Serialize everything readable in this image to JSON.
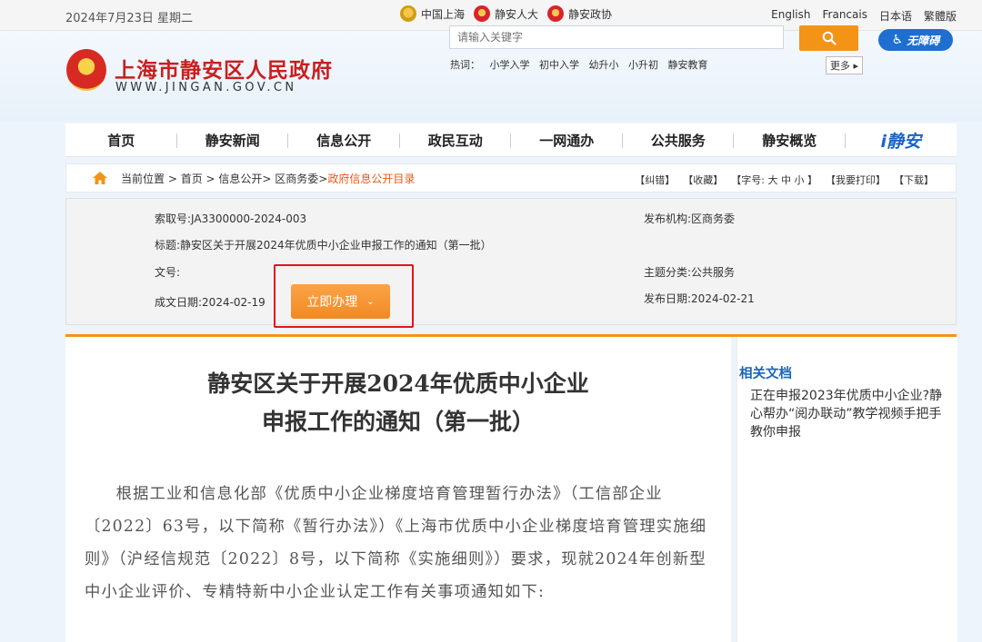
{
  "topbar": {
    "date": "2024年7月23日 星期二",
    "links": [
      "中国上海",
      "静安人大",
      "静安政协"
    ],
    "languages": [
      "English",
      "Francais",
      "日本语",
      "繁體版"
    ]
  },
  "header": {
    "site_title": "上海市静安区人民政府",
    "site_url": "WWW.JINGAN.GOV.CN",
    "search_placeholder": "请输入关键字",
    "hot_label": "热词：",
    "hot_words": [
      "小学入学",
      "初中入学",
      "幼升小",
      "小升初",
      "静安教育"
    ],
    "more_label": "更多",
    "accessibility_label": "无障碍"
  },
  "nav": {
    "items": [
      "首页",
      "信息公开",
      "静安新闻",
      "政民互动",
      "一网通办",
      "公共服务",
      "静安概览"
    ],
    "brand": "i静安"
  },
  "breadcrumb": {
    "label": "当前位置 >",
    "parts": [
      "首页 >",
      "信息公开>",
      "区商务委>"
    ],
    "current": "政府信息公开目录",
    "tools": [
      "【纠错】",
      "【收藏】",
      "【字号: 大 中 小 】",
      "【我要打印】",
      "【下载】"
    ]
  },
  "info": {
    "index_no": "索取号:JA3300000-2024-003",
    "title": "标题:静安区关于开展2024年优质中小企业申报工作的通知（第一批）",
    "doc_no": "文号:",
    "created": "成文日期:2024-02-19",
    "publisher": "发布机构:区商务委",
    "category": "主题分类:公共服务",
    "published": "发布日期:2024-02-21",
    "action_label": "立即办理"
  },
  "article": {
    "title_line1": "静安区关于开展2024年优质中小企业",
    "title_line2": "申报工作的通知（第一批）",
    "body": "根据工业和信息化部《优质中小企业梯度培育管理暂行办法》（工信部企业〔2022〕63号，以下简称《暂行办法》）《上海市优质中小企业梯度培育管理实施细则》（沪经信规范〔2022〕8号，以下简称《实施细则》）要求，现就2024年创新型中小企业评价、专精特新中小企业认定工作有关事项通知如下:"
  },
  "sidebar": {
    "heading": "相关文档",
    "items": [
      "正在申报2023年优质中小企业?静心帮办“阅办联动”教学视频手把手教你申报"
    ]
  },
  "colors": {
    "accent": "#f39417",
    "title_red": "#c81f1f",
    "link_blue": "#1c64b6",
    "highlight": "#e1151a"
  }
}
